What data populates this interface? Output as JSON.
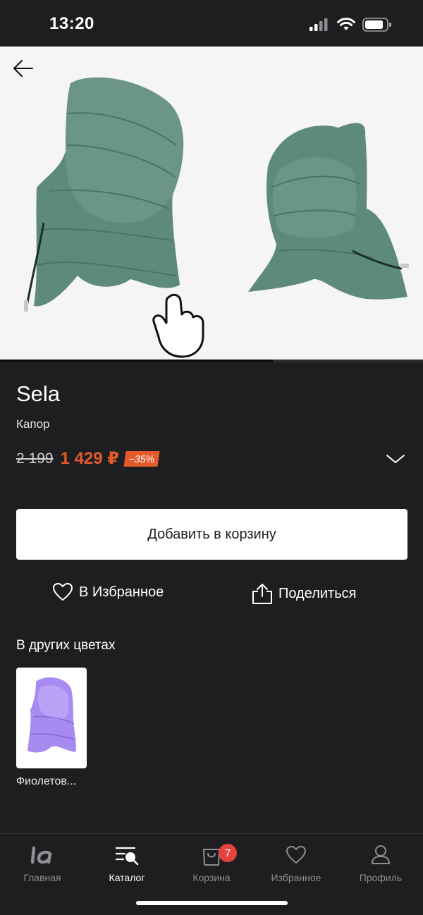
{
  "status_bar": {
    "time": "13:20"
  },
  "gallery": {
    "progress": 0.645
  },
  "product": {
    "brand": "Sela",
    "name": "Капор",
    "old_price": "2 199",
    "new_price": "1 429 ₽",
    "discount": "−35%"
  },
  "actions": {
    "add_to_cart": "Добавить в корзину",
    "favorite": "В Избранное",
    "share": "Поделиться"
  },
  "other_colors": {
    "title": "В других цветах",
    "items": [
      {
        "name": "Фиолетов..."
      }
    ]
  },
  "tabbar": {
    "items": [
      {
        "label": "Главная",
        "icon": "lamoda-logo-icon"
      },
      {
        "label": "Каталог",
        "icon": "catalog-search-icon",
        "active": true
      },
      {
        "label": "Корзина",
        "icon": "shopping-bag-icon",
        "badge": "7"
      },
      {
        "label": "Избранное",
        "icon": "heart-icon"
      },
      {
        "label": "Профиль",
        "icon": "profile-icon"
      }
    ]
  },
  "colors": {
    "accent": "#e35a2b",
    "background": "#1e1e20",
    "badge": "#e3433b"
  }
}
